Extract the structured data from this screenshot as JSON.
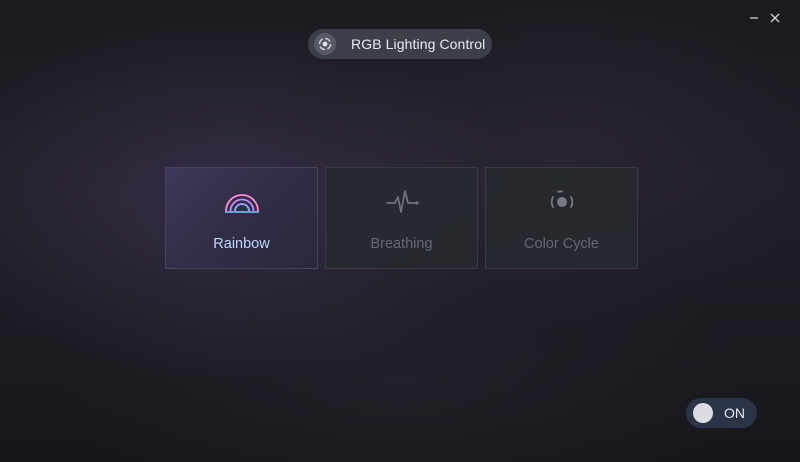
{
  "window": {
    "minimize_icon": "minimize-icon",
    "close_icon": "close-icon"
  },
  "header": {
    "title": "RGB Lighting Control",
    "logo_icon": "rgb-ring-icon"
  },
  "modes": [
    {
      "label": "Rainbow",
      "icon": "rainbow-icon",
      "active": true
    },
    {
      "label": "Breathing",
      "icon": "pulse-wave-icon",
      "active": false
    },
    {
      "label": "Color Cycle",
      "icon": "orbit-cycle-icon",
      "active": false
    }
  ],
  "power_toggle": {
    "state_label": "ON",
    "on": true
  },
  "colors": {
    "accent_label": "#bcd6ff",
    "rainbow_top": "#ff8fd8",
    "rainbow_middle": "#b08cff",
    "rainbow_bottom": "#7ec7ff",
    "inactive": "#646874"
  }
}
